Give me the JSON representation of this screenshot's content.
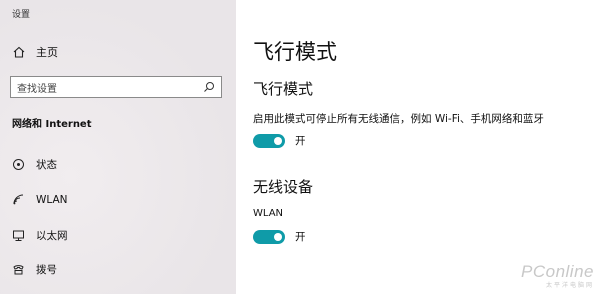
{
  "app": {
    "title": "设置"
  },
  "sidebar": {
    "home_label": "主页",
    "search_placeholder": "查找设置",
    "section_title": "网络和 Internet",
    "items": [
      {
        "label": "状态",
        "icon": "status-icon"
      },
      {
        "label": "WLAN",
        "icon": "wifi-icon"
      },
      {
        "label": "以太网",
        "icon": "ethernet-icon"
      },
      {
        "label": "拨号",
        "icon": "dialup-icon"
      }
    ]
  },
  "main": {
    "page_title": "飞行模式",
    "airplane": {
      "heading": "飞行模式",
      "description": "启用此模式可停止所有无线通信，例如 Wi-Fi、手机网络和蓝牙",
      "toggle_state": "开"
    },
    "wireless": {
      "heading": "无线设备",
      "device_label": "WLAN",
      "toggle_state": "开"
    }
  },
  "watermark": {
    "brand": "PConline",
    "tagline": "太平洋电脑网"
  },
  "colors": {
    "accent": "#0f9ba8",
    "sidebar_bg": "#ece8ea"
  }
}
